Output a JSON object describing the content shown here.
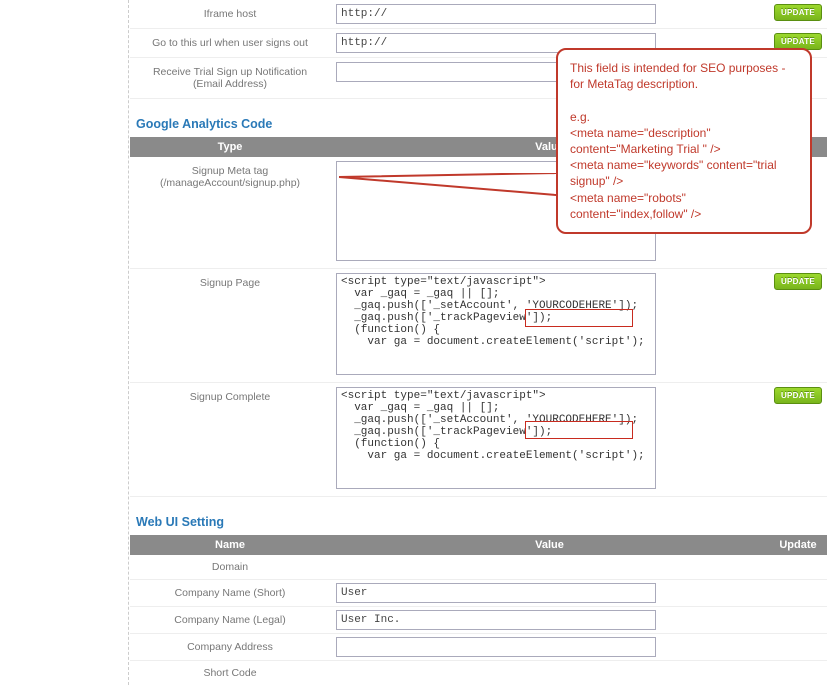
{
  "topRows": {
    "iframe": {
      "label": "Iframe host",
      "value": "http://",
      "update": "UPDATE"
    },
    "signout": {
      "label": "Go to this url when user signs out",
      "value": "http://",
      "update": "UPDATE"
    },
    "trialEmail": {
      "label": "Receive Trial Sign up Notification (Email Address)",
      "value": ""
    }
  },
  "ga": {
    "title": "Google Analytics Code",
    "head": {
      "type": "Type",
      "value": "Value"
    },
    "meta": {
      "label_line1": "Signup Meta tag",
      "label_line2": "(/manageAccount/signup.php)",
      "value": ""
    },
    "page": {
      "label": "Signup Page",
      "value": "<script type=\"text/javascript\">\n  var _gaq = _gaq || [];\n  _gaq.push(['_setAccount', 'YOURCODEHERE']);\n  _gaq.push(['_trackPageview']);\n  (function() {\n    var ga = document.createElement('script');",
      "update": "UPDATE"
    },
    "complete": {
      "label": "Signup Complete",
      "value": "<script type=\"text/javascript\">\n  var _gaq = _gaq || [];\n  _gaq.push(['_setAccount', 'YOURCODEHERE']);\n  _gaq.push(['_trackPageview']);\n  (function() {\n    var ga = document.createElement('script');",
      "update": "UPDATE"
    }
  },
  "webui": {
    "title": "Web UI Setting",
    "head": {
      "name": "Name",
      "value": "Value",
      "update": "Update"
    },
    "rows": [
      {
        "label": "Domain",
        "value": ""
      },
      {
        "label": "Company Name (Short)",
        "value": "User"
      },
      {
        "label": "Company Name (Legal)",
        "value": "User Inc."
      },
      {
        "label": "Company Address",
        "value": ""
      },
      {
        "label": "Short Code",
        "value": ""
      }
    ]
  },
  "callout": {
    "line1": "This field is intended for SEO purposes - for MetaTag description.",
    "line2": "e.g.",
    "line3": "<meta name=\"description\" content=\"Marketing Trial \" />",
    "line4": "<meta name=\"keywords\" content=\"trial signup\" />",
    "line5": "<meta name=\"robots\" content=\"index,follow\" />"
  }
}
